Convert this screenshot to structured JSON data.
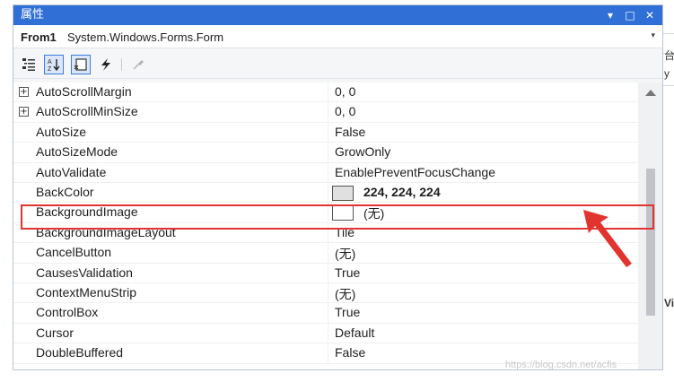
{
  "titlebar": {
    "title": "属性",
    "controls": [
      "▾",
      "□",
      "✕"
    ]
  },
  "object": {
    "name": "From1",
    "type": "System.Windows.Forms.Form",
    "dropdown": "▾"
  },
  "toolbar": {
    "icons": [
      "categorized-icon",
      "alphabetical-icon",
      "properties-icon",
      "events-icon",
      "property-pages-icon"
    ]
  },
  "properties": [
    {
      "name": "AutoScrollMargin",
      "value": "0, 0",
      "expandable": true
    },
    {
      "name": "AutoScrollMinSize",
      "value": "0, 0",
      "expandable": true
    },
    {
      "name": "AutoSize",
      "value": "False"
    },
    {
      "name": "AutoSizeMode",
      "value": "GrowOnly"
    },
    {
      "name": "AutoValidate",
      "value": "EnablePreventFocusChange"
    },
    {
      "name": "BackColor",
      "value": "224, 224, 224",
      "swatch": "#e0e0e0",
      "bold": true
    },
    {
      "name": "BackgroundImage",
      "value": "(无)",
      "swatch": "#ffffff"
    },
    {
      "name": "BackgroundImageLayout",
      "value": "Tile"
    },
    {
      "name": "CancelButton",
      "value": "(无)"
    },
    {
      "name": "CausesValidation",
      "value": "True"
    },
    {
      "name": "ContextMenuStrip",
      "value": "(无)"
    },
    {
      "name": "ControlBox",
      "value": "True"
    },
    {
      "name": "Cursor",
      "value": "Default"
    },
    {
      "name": "DoubleBuffered",
      "value": "False"
    }
  ],
  "highlight_color": "#e2342f",
  "edge_fragments": [
    "台",
    "y",
    "Vi"
  ],
  "watermark": "https://blog.csdn.net/acfis"
}
